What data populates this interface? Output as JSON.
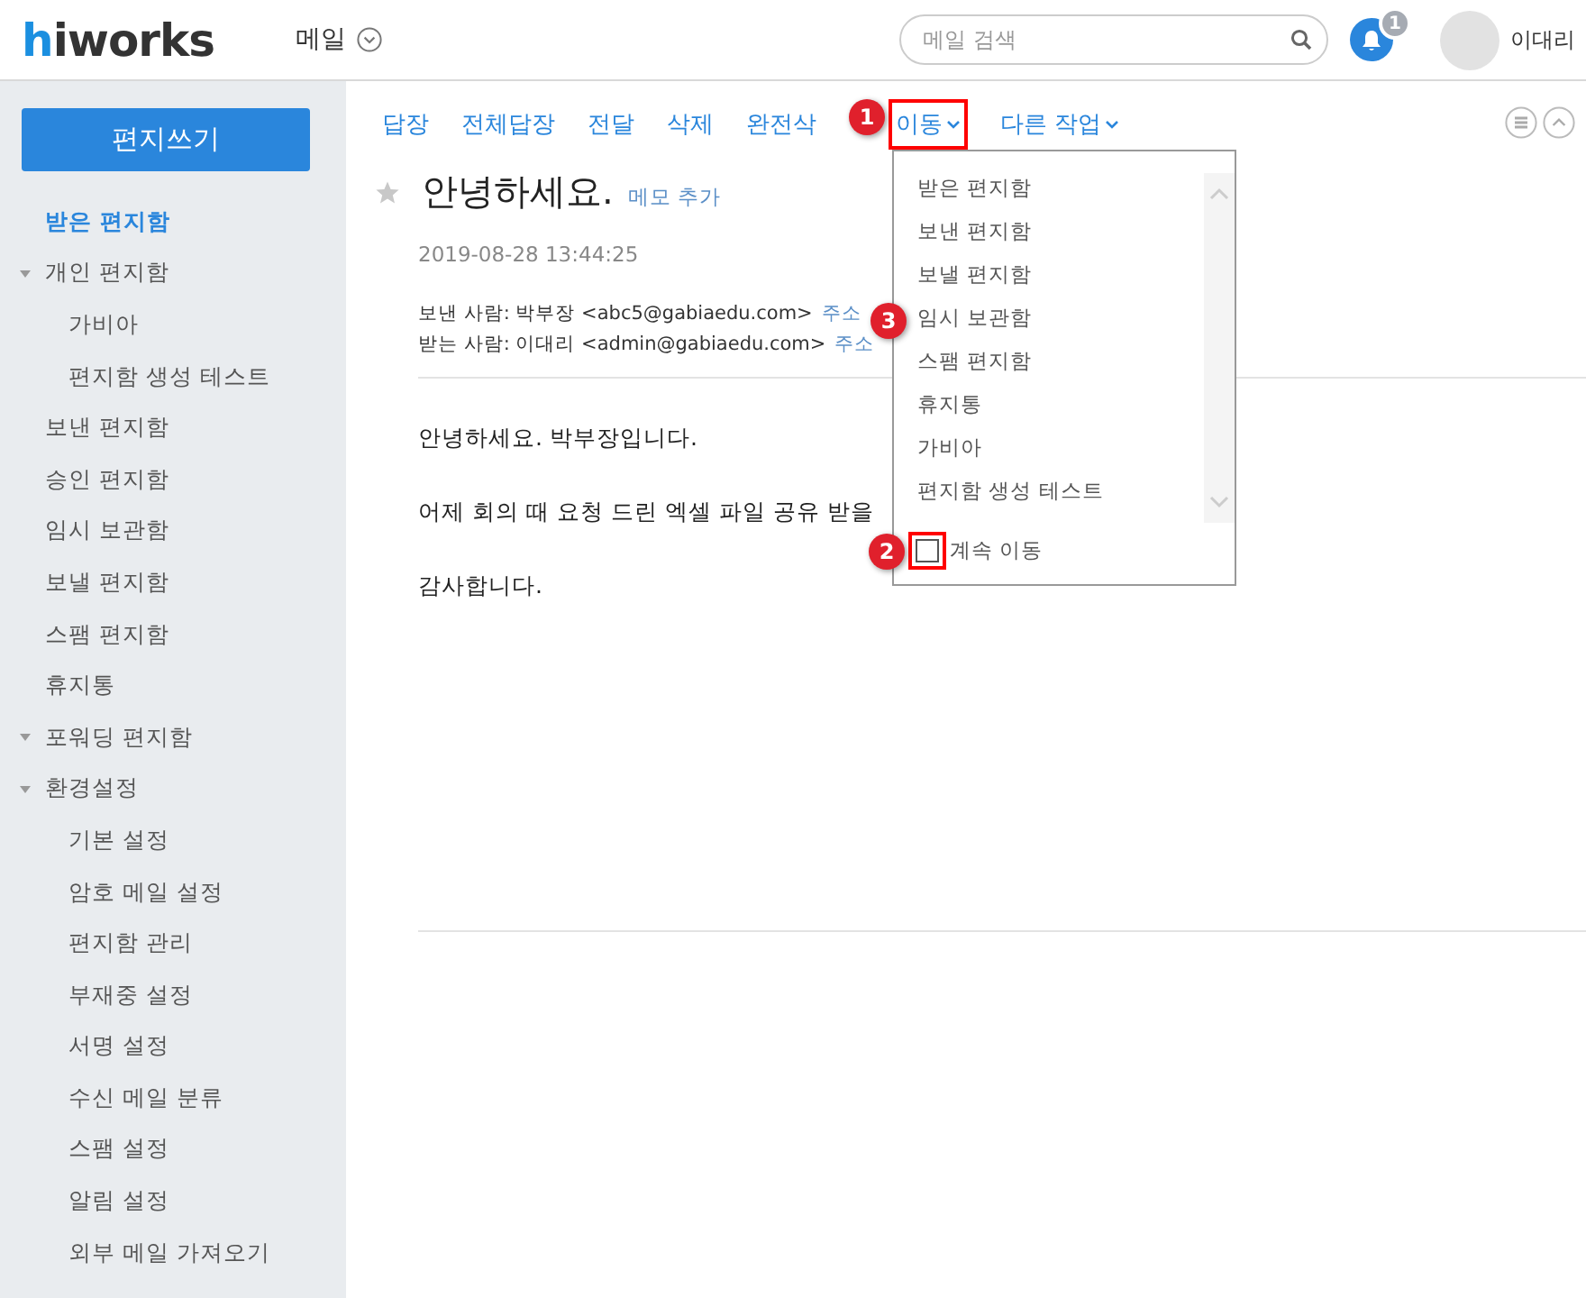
{
  "header": {
    "logo": {
      "accent": "h",
      "rest": "iworks"
    },
    "app_menu": "메일",
    "search": {
      "placeholder": "메일 검색"
    },
    "notifications": {
      "count": "1"
    },
    "user": {
      "name": "이대리"
    }
  },
  "sidebar": {
    "compose_button": "편지쓰기",
    "items": [
      {
        "label": "받은 편지함",
        "selected": true
      },
      {
        "label": "개인 편지함",
        "selected": false,
        "expanded": true,
        "children": [
          {
            "label": "가비아",
            "selected": false
          },
          {
            "label": "편지함 생성 테스트",
            "selected": false
          }
        ]
      },
      {
        "label": "보낸 편지함",
        "selected": false
      },
      {
        "label": "승인 편지함",
        "selected": false
      },
      {
        "label": "임시 보관함",
        "selected": false
      },
      {
        "label": "보낼 편지함",
        "selected": false
      },
      {
        "label": "스팸 편지함",
        "selected": false
      },
      {
        "label": "휴지통",
        "selected": false
      },
      {
        "label": "포워딩 편지함",
        "selected": false,
        "expanded": true
      },
      {
        "label": "환경설정",
        "selected": false,
        "expanded": true,
        "children": [
          {
            "label": "기본 설정",
            "selected": false
          },
          {
            "label": "암호 메일 설정",
            "selected": false
          },
          {
            "label": "편지함 관리",
            "selected": false
          },
          {
            "label": "부재중 설정",
            "selected": false
          },
          {
            "label": "서명 설정",
            "selected": false
          },
          {
            "label": "수신 메일 분류",
            "selected": false
          },
          {
            "label": "스팸 설정",
            "selected": false
          },
          {
            "label": "알림 설정",
            "selected": false
          },
          {
            "label": "외부 메일 가져오기",
            "selected": false
          }
        ]
      }
    ]
  },
  "toolbar": {
    "actions": [
      {
        "label": "답장",
        "kind": "link"
      },
      {
        "label": "전체답장",
        "kind": "link"
      },
      {
        "label": "전달",
        "kind": "link"
      },
      {
        "label": "삭제",
        "kind": "link"
      },
      {
        "label": "완전삭",
        "kind": "link"
      },
      {
        "label": "이동",
        "kind": "dropdown"
      },
      {
        "label": "다른 작업",
        "kind": "dropdown"
      }
    ]
  },
  "move_menu": {
    "items": [
      {
        "label": "받은 편지함"
      },
      {
        "label": "보낸 편지함"
      },
      {
        "label": "보낼 편지함"
      },
      {
        "label": "임시 보관함"
      },
      {
        "label": "스팸 편지함"
      },
      {
        "label": "휴지통"
      },
      {
        "label": "가비아"
      },
      {
        "label": "편지함 생성 테스트"
      }
    ],
    "keep_moving": {
      "label": "계속 이동",
      "checked": false
    }
  },
  "message": {
    "subject": "안녕하세요.",
    "starred": false,
    "memo_link": "메모 추가",
    "date": "2019-08-28 13:44:25",
    "from": {
      "label": "보낸 사람: 박부장 <abc5@gabiaedu.com>",
      "link": "주소"
    },
    "to": {
      "label": "받는 사람: 이대리 <admin@gabiaedu.com>",
      "link": "주소"
    },
    "body": [
      "안녕하세요. 박부장입니다.",
      "어제 회의 때 요청 드린 엑셀 파일 공유 받을",
      "감사합니다."
    ]
  },
  "annotations": [
    {
      "number": "1"
    },
    {
      "number": "2"
    },
    {
      "number": "3"
    }
  ]
}
